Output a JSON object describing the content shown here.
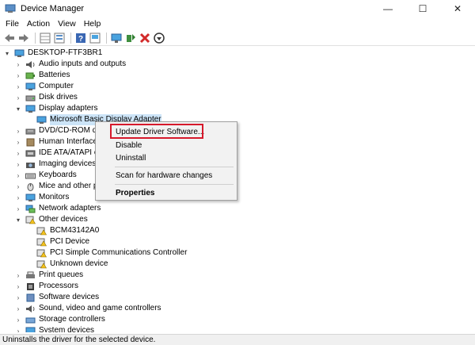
{
  "window": {
    "title": "Device Manager",
    "minimize": "—",
    "maximize": "☐",
    "close": "✕"
  },
  "menu": [
    "File",
    "Action",
    "View",
    "Help"
  ],
  "toolbar_icons": [
    "back-icon",
    "forward-icon",
    "properties-grid-icon",
    "details-icon",
    "help-icon",
    "scan-icon",
    "monitor-icon",
    "update-driver-icon",
    "uninstall-icon",
    "disable-icon"
  ],
  "tree": {
    "root": "DESKTOP-FTF3BR1",
    "items": [
      {
        "label": "Audio inputs and outputs",
        "icon": "speaker-icon"
      },
      {
        "label": "Batteries",
        "icon": "battery-icon"
      },
      {
        "label": "Computer",
        "icon": "computer-icon"
      },
      {
        "label": "Disk drives",
        "icon": "disk-icon"
      },
      {
        "label": "Display adapters",
        "icon": "display-icon"
      },
      {
        "label": "Microsoft Basic Display Adapter",
        "icon": "display-icon"
      },
      {
        "label": "DVD/CD-ROM dri",
        "icon": "dvd-icon"
      },
      {
        "label": "Human Interface",
        "icon": "hid-icon"
      },
      {
        "label": "IDE ATA/ATAPI co",
        "icon": "ide-icon"
      },
      {
        "label": "Imaging devices",
        "icon": "camera-icon"
      },
      {
        "label": "Keyboards",
        "icon": "keyboard-icon"
      },
      {
        "label": "Mice and other po",
        "icon": "mouse-icon"
      },
      {
        "label": "Monitors",
        "icon": "monitor-icon"
      },
      {
        "label": "Network adapters",
        "icon": "network-icon"
      },
      {
        "label": "Other devices",
        "icon": "warning-device-icon"
      },
      {
        "label": "BCM43142A0",
        "icon": "warning-device-icon"
      },
      {
        "label": "PCI Device",
        "icon": "warning-device-icon"
      },
      {
        "label": "PCI Simple Communications Controller",
        "icon": "warning-device-icon"
      },
      {
        "label": "Unknown device",
        "icon": "warning-device-icon"
      },
      {
        "label": "Print queues",
        "icon": "printer-icon"
      },
      {
        "label": "Processors",
        "icon": "processor-icon"
      },
      {
        "label": "Software devices",
        "icon": "software-icon"
      },
      {
        "label": "Sound, video and game controllers",
        "icon": "speaker-icon"
      },
      {
        "label": "Storage controllers",
        "icon": "storage-icon"
      },
      {
        "label": "System devices",
        "icon": "system-icon"
      }
    ]
  },
  "context_menu": {
    "update": "Update Driver Software...",
    "disable": "Disable",
    "uninstall": "Uninstall",
    "scan": "Scan for hardware changes",
    "properties": "Properties"
  },
  "status": "Uninstalls the driver for the selected device.",
  "colors": {
    "highlight_border": "#d6192b",
    "selection": "#cce4f7"
  }
}
